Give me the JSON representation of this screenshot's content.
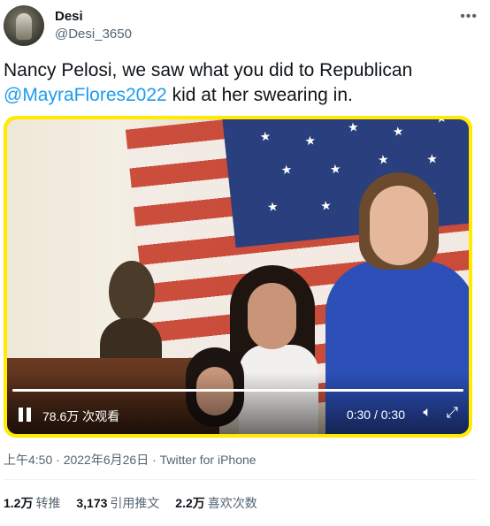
{
  "user": {
    "name": "Desi",
    "handle": "@Desi_3650"
  },
  "tweet": {
    "text_part1": "Nancy Pelosi, we saw what you did to Republican ",
    "mention": "@MayraFlores2022",
    "text_part2": " kid at her swearing in."
  },
  "video": {
    "views": "78.6万 次观看",
    "time": "0:30 / 0:30",
    "progress": 1.0,
    "border_color": "#ffea00"
  },
  "meta": {
    "timestamp": "上午4:50 · 2022年6月26日 · Twitter for iPhone"
  },
  "stats": [
    {
      "count": "1.2万",
      "label": "转推"
    },
    {
      "count": "3,173",
      "label": "引用推文"
    },
    {
      "count": "2.2万",
      "label": "喜欢次数"
    }
  ],
  "colors": {
    "accent": "#1d9bf0",
    "secondary_text": "#536471"
  }
}
